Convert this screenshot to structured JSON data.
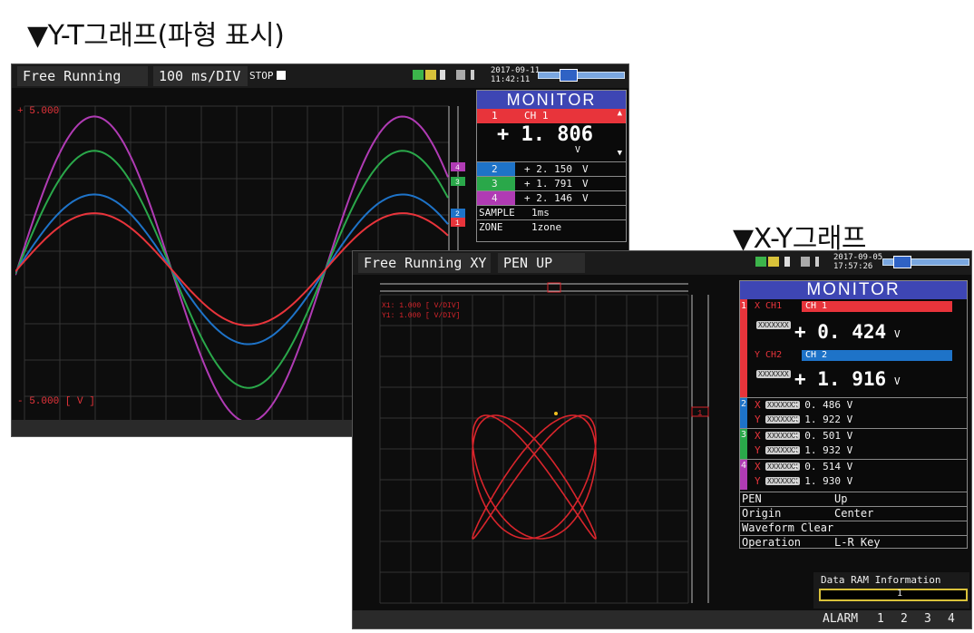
{
  "captions": {
    "yt": "▼Y-T그래프(파형 표시)",
    "xy": "▼X-Y그래프"
  },
  "colors": {
    "ch1": "#e8343b",
    "ch2": "#1e73c8",
    "ch3": "#2aa84a",
    "ch4": "#b03bb4",
    "monitor_header": "#3e46b4",
    "trace_xy": "#d9252c"
  },
  "yt": {
    "mode": "Free Running",
    "timebase": "100 ms/DIV",
    "stop_label": "STOP",
    "date": "2017-09-11",
    "time": "11:42:11",
    "upper_label": "+ 5.000",
    "lower_label": "- 5.000 [ V        ]",
    "marker_labels": [
      "4",
      "3",
      "2",
      "1"
    ],
    "monitor": {
      "title": "MONITOR",
      "ch1_num": "1",
      "ch1_name": "CH 1",
      "ch1_value": "+  1. 806",
      "ch1_unit": "V",
      "rows": [
        {
          "num": "2",
          "value": "+ 2. 150",
          "unit": "V"
        },
        {
          "num": "3",
          "value": "+ 1. 791",
          "unit": "V"
        },
        {
          "num": "4",
          "value": "+ 2. 146",
          "unit": "V"
        }
      ],
      "sample_label": "SAMPLE",
      "sample_value": "1ms",
      "zone_label": "ZONE",
      "zone_value": "1zone"
    }
  },
  "xy": {
    "mode": "Free Running XY",
    "pen_status": "PEN UP",
    "date": "2017-09-05",
    "time": "17:57:26",
    "scale_x": "X1: 1.000  [ V/DIV]",
    "scale_y": "Y1: 1.000  [ V/DIV]",
    "cursor_label": "1",
    "monitor": {
      "title": "MONITOR",
      "ch1": {
        "num": "1",
        "x_label": "X  CH1",
        "x_name": "CH 1",
        "x_value": "+ 0. 424",
        "x_unit": "V",
        "y_label": "Y  CH2",
        "y_name": "CH 2",
        "y_value": "+ 1. 916",
        "y_unit": "V"
      },
      "pairs": [
        {
          "num": "2",
          "x_value": "+ 0. 486   V",
          "y_value": "+ 1. 922   V"
        },
        {
          "num": "3",
          "x_value": "+ 0. 501   V",
          "y_value": "+ 1. 932   V"
        },
        {
          "num": "4",
          "x_value": "+ 0. 514   V",
          "y_value": "+ 1. 930   V"
        }
      ],
      "badge": "XXXXXXX",
      "settings": [
        {
          "label": "PEN",
          "value": "Up"
        },
        {
          "label": "Origin",
          "value": "Center"
        },
        {
          "label": "Waveform Clear",
          "value": ""
        },
        {
          "label": "Operation",
          "value": "L-R Key"
        }
      ]
    },
    "data_ram_label": "Data RAM Information",
    "data_ram_value": "1",
    "alarm_label": "ALARM",
    "alarm_channels": [
      "1",
      "2",
      "3",
      "4"
    ]
  }
}
